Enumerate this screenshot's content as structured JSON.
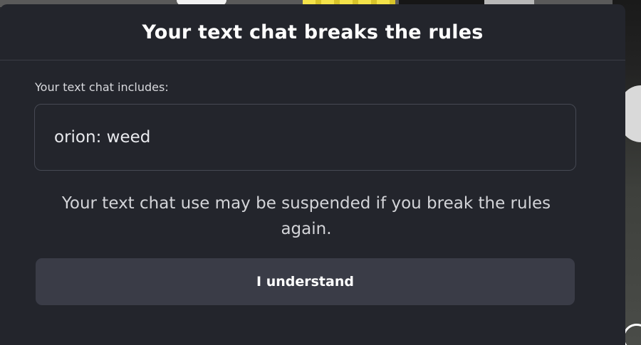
{
  "dialog": {
    "title": "Your text chat breaks the rules",
    "includes_label": "Your text chat includes:",
    "chat_message": "orion: weed",
    "warning": "Your text chat use may be suspended if you break the rules again.",
    "button_label": "I understand"
  },
  "colors": {
    "dialog_background": "#23252c",
    "button_background": "#3a3c47",
    "title_text": "#ffffff",
    "body_text": "#d3d4d8"
  }
}
